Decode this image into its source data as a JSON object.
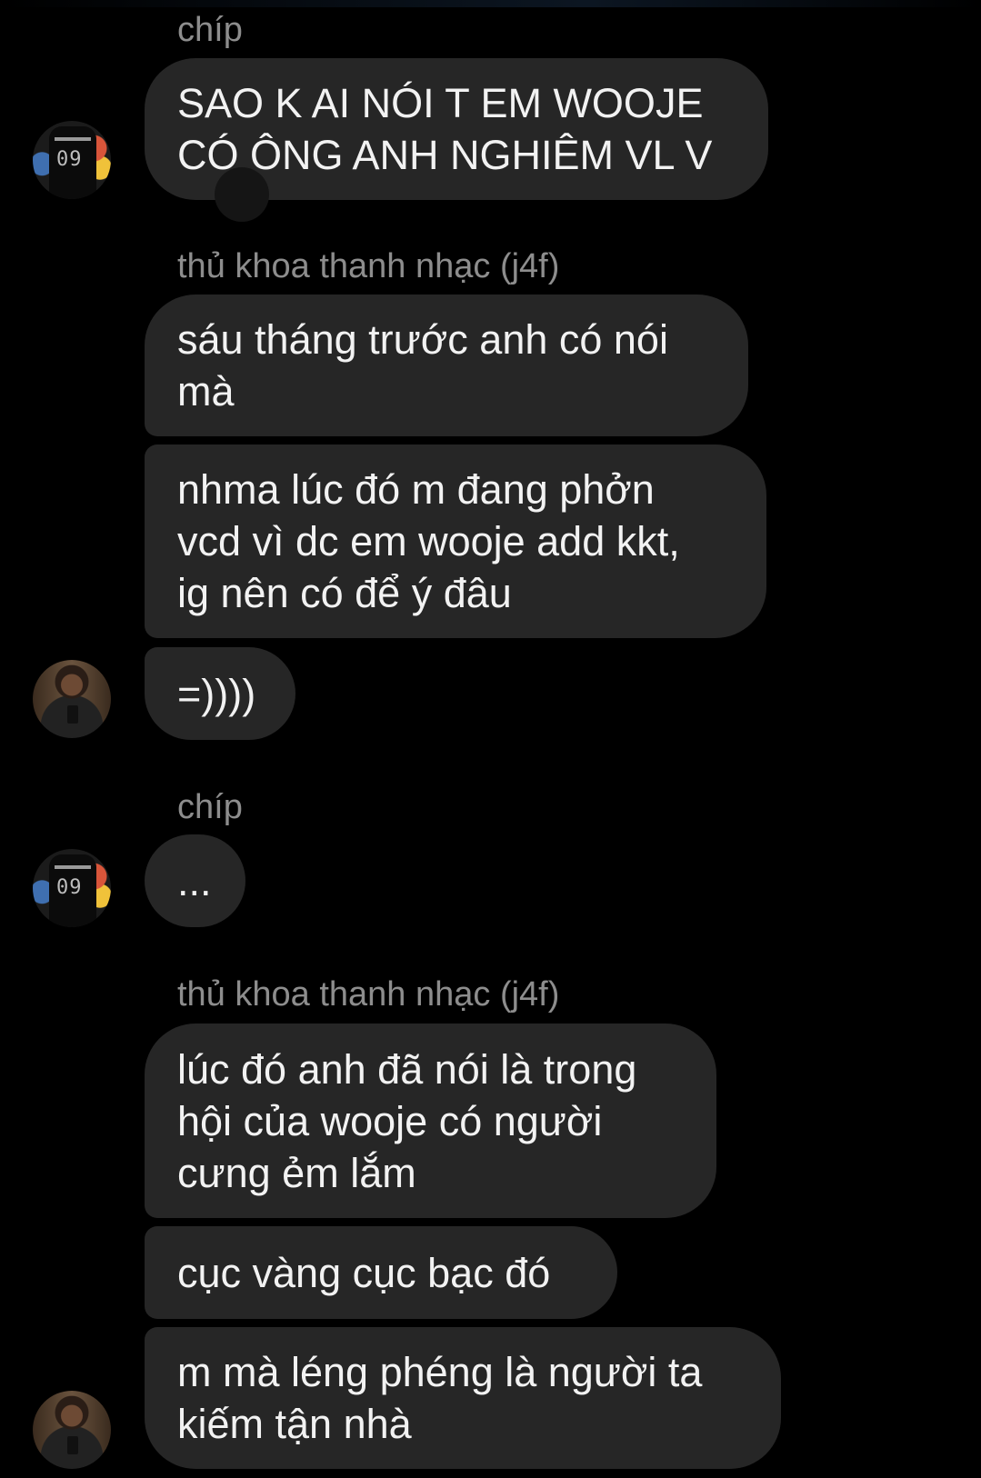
{
  "senders": {
    "chip": "chíp",
    "thanh": "thủ khoa thanh nhạc (j4f)"
  },
  "messages": [
    {
      "text": "SAO K AI NÓI T EM WOOJE\nCÓ ÔNG ANH NGHIÊM VL V"
    },
    {
      "text": "sáu tháng trước anh có nói\nmà"
    },
    {
      "text": "nhma lúc đó m đang phởn\nvcd vì dc em wooje add kkt,\nig nên có để ý đâu"
    },
    {
      "text": "=))))"
    },
    {
      "text": "..."
    },
    {
      "text": "lúc đó anh đã nói là trong\nhội của wooje có người\ncưng ẻm lắm"
    },
    {
      "text": "cục vàng cục bạc đó"
    },
    {
      "text": "m mà léng phéng là người ta\nkiếm tận nhà"
    }
  ],
  "avatars": {
    "chip": "avatar-chip (jersey 09)",
    "thanh": "avatar-thanh (selfie)"
  }
}
